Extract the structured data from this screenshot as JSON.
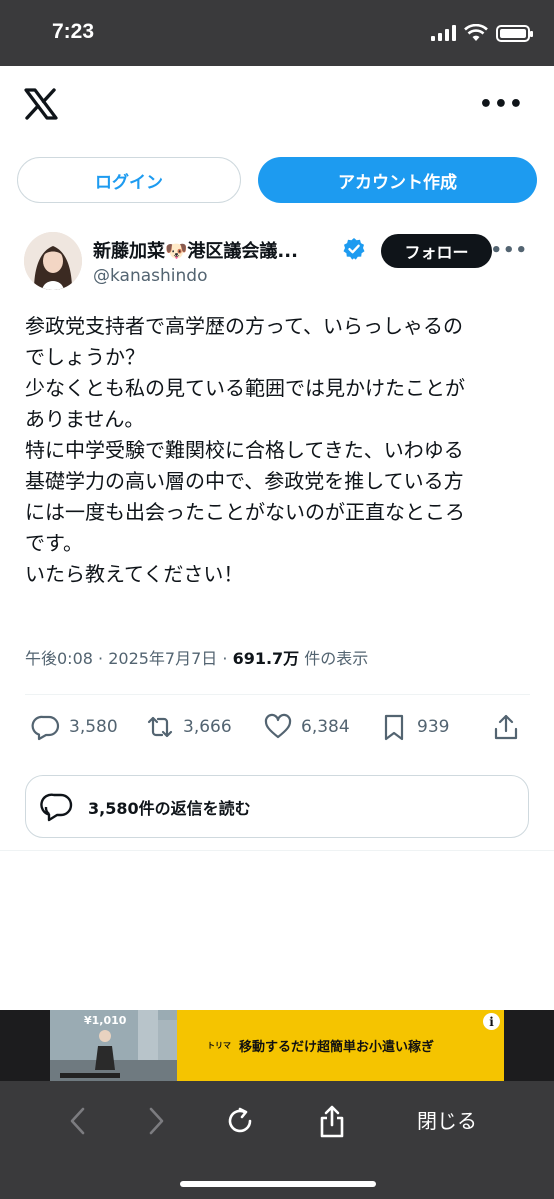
{
  "status_bar": {
    "time": "7:23"
  },
  "header": {
    "logo": "x-logo",
    "more_icon": "more-icon"
  },
  "auth": {
    "login_label": "ログイン",
    "signup_label": "アカウント作成"
  },
  "author": {
    "display_name": "新藤加菜🐶港区議会議...",
    "handle": "@kanashindo",
    "follow_label": "フォロー"
  },
  "tweet": {
    "text": "参政党支持者で高学歴の方って、いらっしゃるの\nでしょうか？\n少なくとも私の見ている範囲では見かけたことが\nありません。\n特に中学受験で難関校に合格してきた、いわゆる\n基礎学力の高い層の中で、参政党を推している方\nには一度も出会ったことがないのが正直なところ\nです。\nいたら教えてください！",
    "time": "午後0:08",
    "date": "2025年7月7日",
    "views": "691.7万",
    "views_suffix": "件の表示"
  },
  "actions": {
    "replies": "3,580",
    "reposts": "3,666",
    "likes": "6,384",
    "bookmarks": "939"
  },
  "read_replies": {
    "label": "3,580件の返信を読む"
  },
  "ad": {
    "price": "¥1,010",
    "brand": "トリマ",
    "copy": "移動するだけ超簡単お小遣い稼ぎ",
    "info": "i"
  },
  "browser_toolbar": {
    "close_label": "閉じる"
  },
  "colors": {
    "accent": "#1d9bf0",
    "dark": "#0f1419",
    "muted": "#536471",
    "chrome": "#3a3a3c"
  }
}
